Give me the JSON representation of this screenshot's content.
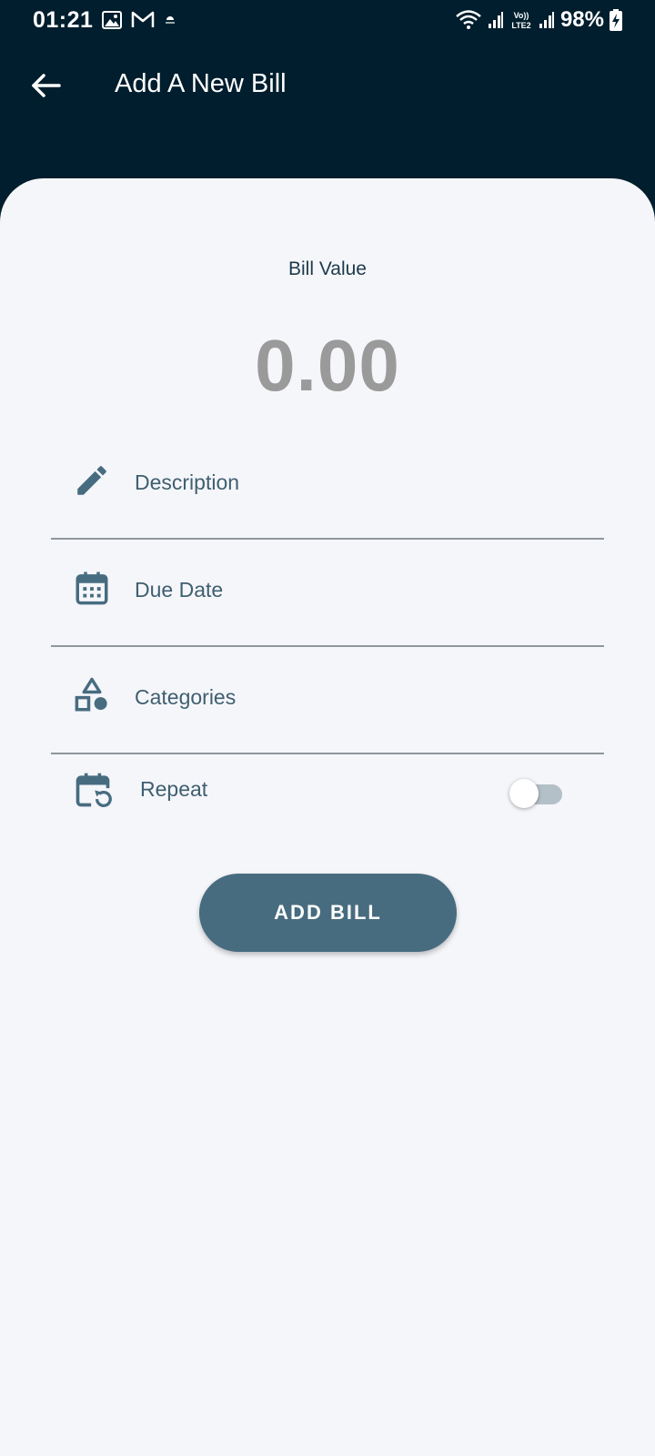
{
  "status_bar": {
    "time": "01:21",
    "battery": "98%",
    "icons": [
      "gallery-icon",
      "gmail-icon",
      "cloud-icon",
      "wifi-icon",
      "signal-icon",
      "volte-icon",
      "signal-icon",
      "battery-charging-icon"
    ],
    "volte_label": "Vo))\nLTE2"
  },
  "app_bar": {
    "title": "Add A New Bill",
    "back_icon": "arrow-left-icon"
  },
  "form": {
    "bill_value_label": "Bill Value",
    "amount": "0.00",
    "fields": [
      {
        "label": "Description",
        "icon": "pencil-icon"
      },
      {
        "label": "Due Date",
        "icon": "calendar-icon"
      },
      {
        "label": "Categories",
        "icon": "shapes-icon"
      }
    ],
    "repeat": {
      "label": "Repeat",
      "icon": "calendar-repeat-icon",
      "enabled": false
    },
    "submit_label": "ADD BILL"
  },
  "colors": {
    "app_bar_bg": "#001e2d",
    "sheet_bg": "#f5f6fa",
    "accent": "#476c80",
    "field_text": "#3f5f70",
    "amount_text": "#9a9a9a"
  }
}
